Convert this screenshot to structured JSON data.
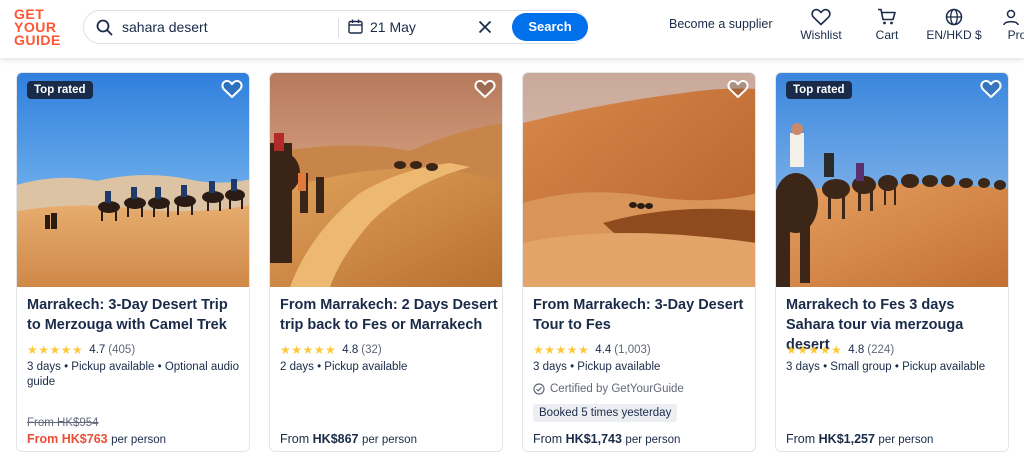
{
  "header": {
    "logo_lines": [
      "GET",
      "YOUR",
      "GUIDE"
    ],
    "search_query": "sahara desert",
    "date": "21 May",
    "search_button": "Search",
    "become_supplier": "Become a supplier",
    "nav": {
      "wishlist": "Wishlist",
      "cart": "Cart",
      "currency": "EN/HKD $",
      "profile": "Profi"
    }
  },
  "colors": {
    "brand": "#ff5533",
    "accent": "#0071eb",
    "sale": "#eb4f31",
    "star": "#fdc93b"
  },
  "cards": [
    {
      "badge": "Top rated",
      "title": "Marrakech: 3-Day Desert Trip to Merzouga with Camel Trek",
      "rating": "4.7",
      "reviews": "(405)",
      "meta": "3 days • Pickup available • Optional audio guide",
      "old_price": "From HK$954",
      "price_prefix": "From ",
      "price": "HK$763",
      "per": "per person"
    },
    {
      "title": "From Marrakech: 2 Days Desert trip back to Fes or Marrakech",
      "rating": "4.8",
      "reviews": "(32)",
      "meta": "2 days • Pickup available",
      "price_prefix": "From ",
      "price": "HK$867",
      "per": "per person"
    },
    {
      "title": "From Marrakech: 3-Day Desert Tour to Fes",
      "rating": "4.4",
      "reviews": "(1,003)",
      "meta": "3 days • Pickup available",
      "certified": "Certified by GetYourGuide",
      "booked": "Booked 5 times yesterday",
      "price_prefix": "From ",
      "price": "HK$1,743",
      "per": "per person"
    },
    {
      "badge": "Top rated",
      "title": "Marrakech to Fes 3 days Sahara tour via merzouga desert",
      "rating": "4.8",
      "reviews": "(224)",
      "meta": "3 days • Small group • Pickup available",
      "price_prefix": "From ",
      "price": "HK$1,257",
      "per": "per person"
    }
  ]
}
